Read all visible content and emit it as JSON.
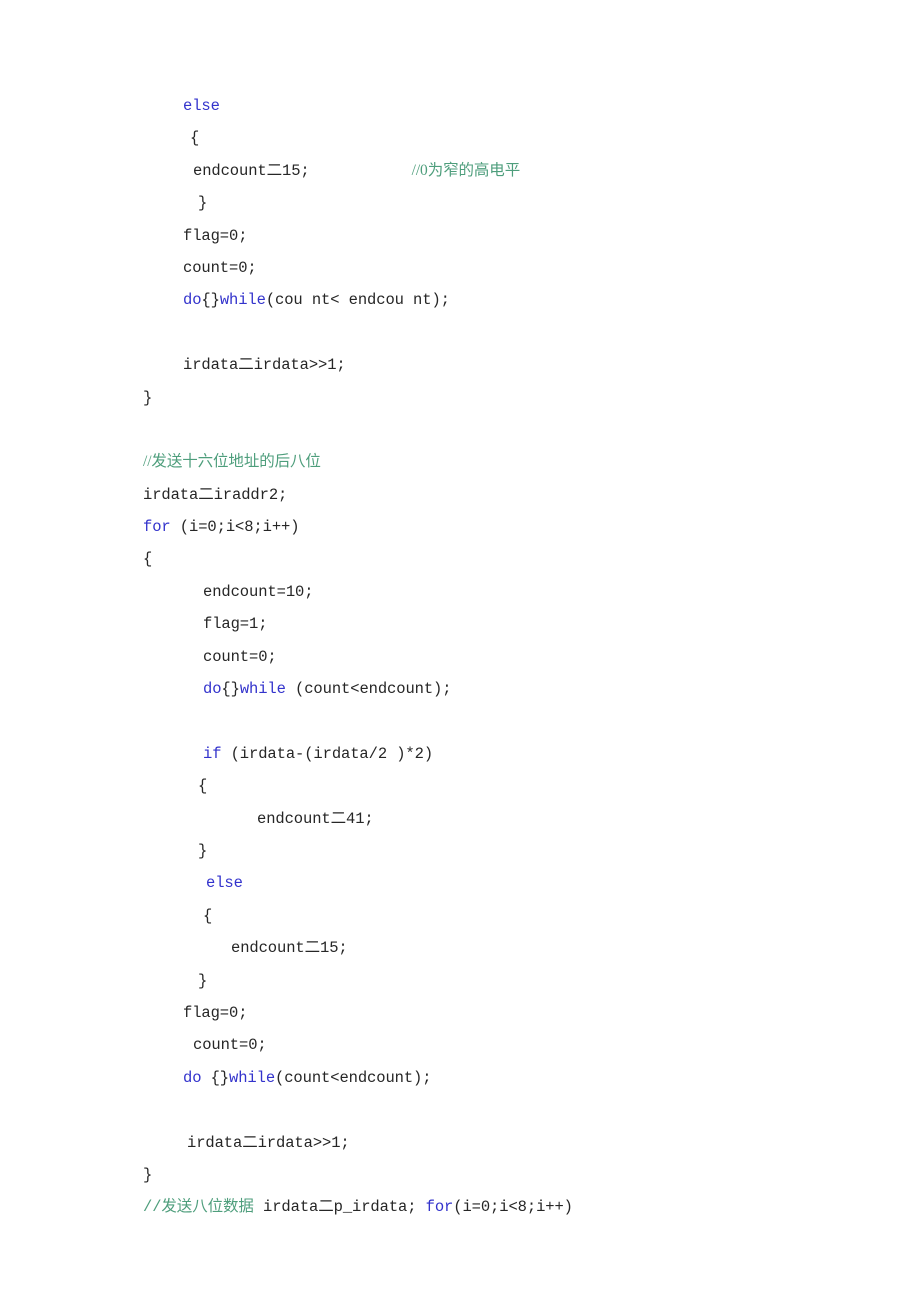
{
  "document": {
    "kind": "source-code-listing",
    "language": "c",
    "background_color": "#ffffff",
    "colors": {
      "text": "#262626",
      "keyword": "#3333cc",
      "comment": "#4e9e7c"
    }
  },
  "code": {
    "lines": [
      {
        "id": "l01",
        "indent": 1,
        "segments": [
          {
            "kind": "keyword",
            "text": "else"
          }
        ]
      },
      {
        "id": "l02",
        "indent": 2,
        "segments": [
          {
            "kind": "plain",
            "text": "{"
          }
        ]
      },
      {
        "id": "l03",
        "indent": 3,
        "segments": [
          {
            "kind": "plain",
            "text": "endcount二15;"
          },
          {
            "kind": "trailing-comment",
            "text": "//0为窄的高电平"
          }
        ]
      },
      {
        "id": "l04",
        "indent": 4,
        "segments": [
          {
            "kind": "plain",
            "text": "}"
          }
        ]
      },
      {
        "id": "l05",
        "indent": 1,
        "segments": [
          {
            "kind": "plain",
            "text": "flag=0;"
          }
        ]
      },
      {
        "id": "l06",
        "indent": 1,
        "segments": [
          {
            "kind": "plain",
            "text": "count=0;"
          }
        ]
      },
      {
        "id": "l07",
        "indent": 1,
        "segments": [
          {
            "kind": "keyword",
            "text": "do"
          },
          {
            "kind": "plain",
            "text": "{}"
          },
          {
            "kind": "keyword",
            "text": "while"
          },
          {
            "kind": "plain",
            "text": "(cou nt< endcou nt);"
          }
        ]
      },
      {
        "id": "l08",
        "indent": 0,
        "segments": []
      },
      {
        "id": "l09",
        "indent": 1,
        "segments": [
          {
            "kind": "plain",
            "text": "irdata二irdata>>1;"
          }
        ]
      },
      {
        "id": "l10",
        "indent": 0,
        "segments": [
          {
            "kind": "plain",
            "text": "}"
          }
        ]
      },
      {
        "id": "l11",
        "indent": 0,
        "segments": []
      },
      {
        "id": "l12",
        "indent": 0,
        "segments": [
          {
            "kind": "comment",
            "text": "//发送十六位地址的后八位"
          }
        ]
      },
      {
        "id": "l13",
        "indent": 0,
        "segments": [
          {
            "kind": "plain",
            "text": "irdata二iraddr2;"
          }
        ]
      },
      {
        "id": "l14",
        "indent": 0,
        "segments": [
          {
            "kind": "keyword",
            "text": "for"
          },
          {
            "kind": "plain",
            "text": " (i=0;i<8;i++)"
          }
        ]
      },
      {
        "id": "l15",
        "indent": 0,
        "segments": [
          {
            "kind": "plain",
            "text": "{"
          }
        ]
      },
      {
        "id": "l16",
        "indent": 5,
        "segments": [
          {
            "kind": "plain",
            "text": "endcount=10;"
          }
        ]
      },
      {
        "id": "l17",
        "indent": 5,
        "segments": [
          {
            "kind": "plain",
            "text": "flag=1;"
          }
        ]
      },
      {
        "id": "l18",
        "indent": 5,
        "segments": [
          {
            "kind": "plain",
            "text": "count=0;"
          }
        ]
      },
      {
        "id": "l19",
        "indent": 5,
        "segments": [
          {
            "kind": "keyword",
            "text": "do"
          },
          {
            "kind": "plain",
            "text": "{}"
          },
          {
            "kind": "keyword",
            "text": "while"
          },
          {
            "kind": "plain",
            "text": " (count<endcount);"
          }
        ]
      },
      {
        "id": "l20",
        "indent": 0,
        "segments": []
      },
      {
        "id": "l21",
        "indent": 5,
        "segments": [
          {
            "kind": "keyword",
            "text": "if"
          },
          {
            "kind": "plain",
            "text": " (irdata-(irdata/2 )*2)"
          }
        ]
      },
      {
        "id": "l22",
        "indent": 4,
        "segments": [
          {
            "kind": "plain",
            "text": "{"
          }
        ]
      },
      {
        "id": "l23",
        "indent": 6,
        "segments": [
          {
            "kind": "plain",
            "text": "endcount二41;"
          }
        ]
      },
      {
        "id": "l24",
        "indent": 4,
        "segments": [
          {
            "kind": "plain",
            "text": "}"
          }
        ]
      },
      {
        "id": "l25",
        "indent": 7,
        "segments": [
          {
            "kind": "keyword",
            "text": "else"
          }
        ]
      },
      {
        "id": "l26",
        "indent": 5,
        "segments": [
          {
            "kind": "plain",
            "text": "{"
          }
        ]
      },
      {
        "id": "l27",
        "indent": 8,
        "segments": [
          {
            "kind": "plain",
            "text": "endcount二15;"
          }
        ]
      },
      {
        "id": "l28",
        "indent": 4,
        "segments": [
          {
            "kind": "plain",
            "text": "}"
          }
        ]
      },
      {
        "id": "l29",
        "indent": 1,
        "segments": [
          {
            "kind": "plain",
            "text": "flag=0;"
          }
        ]
      },
      {
        "id": "l30",
        "indent": 3,
        "segments": [
          {
            "kind": "plain",
            "text": "count=0;"
          }
        ]
      },
      {
        "id": "l31",
        "indent": 1,
        "segments": [
          {
            "kind": "keyword",
            "text": "do"
          },
          {
            "kind": "plain",
            "text": " {}"
          },
          {
            "kind": "keyword",
            "text": "while"
          },
          {
            "kind": "plain",
            "text": "(count<endcount);"
          }
        ]
      },
      {
        "id": "l32",
        "indent": 0,
        "segments": []
      },
      {
        "id": "l33",
        "indent": 9,
        "segments": [
          {
            "kind": "plain",
            "text": "irdata二irdata>>1;"
          }
        ]
      },
      {
        "id": "l34",
        "indent": 0,
        "segments": [
          {
            "kind": "plain",
            "text": "}"
          }
        ]
      },
      {
        "id": "l35",
        "indent": 0,
        "segments": [
          {
            "kind": "comment-mono",
            "text": "//发送八位数据"
          },
          {
            "kind": "plain",
            "text": " irdata二p_irdata; "
          },
          {
            "kind": "keyword",
            "text": "for"
          },
          {
            "kind": "plain",
            "text": "(i=0;i<8;i++)"
          }
        ]
      }
    ]
  }
}
